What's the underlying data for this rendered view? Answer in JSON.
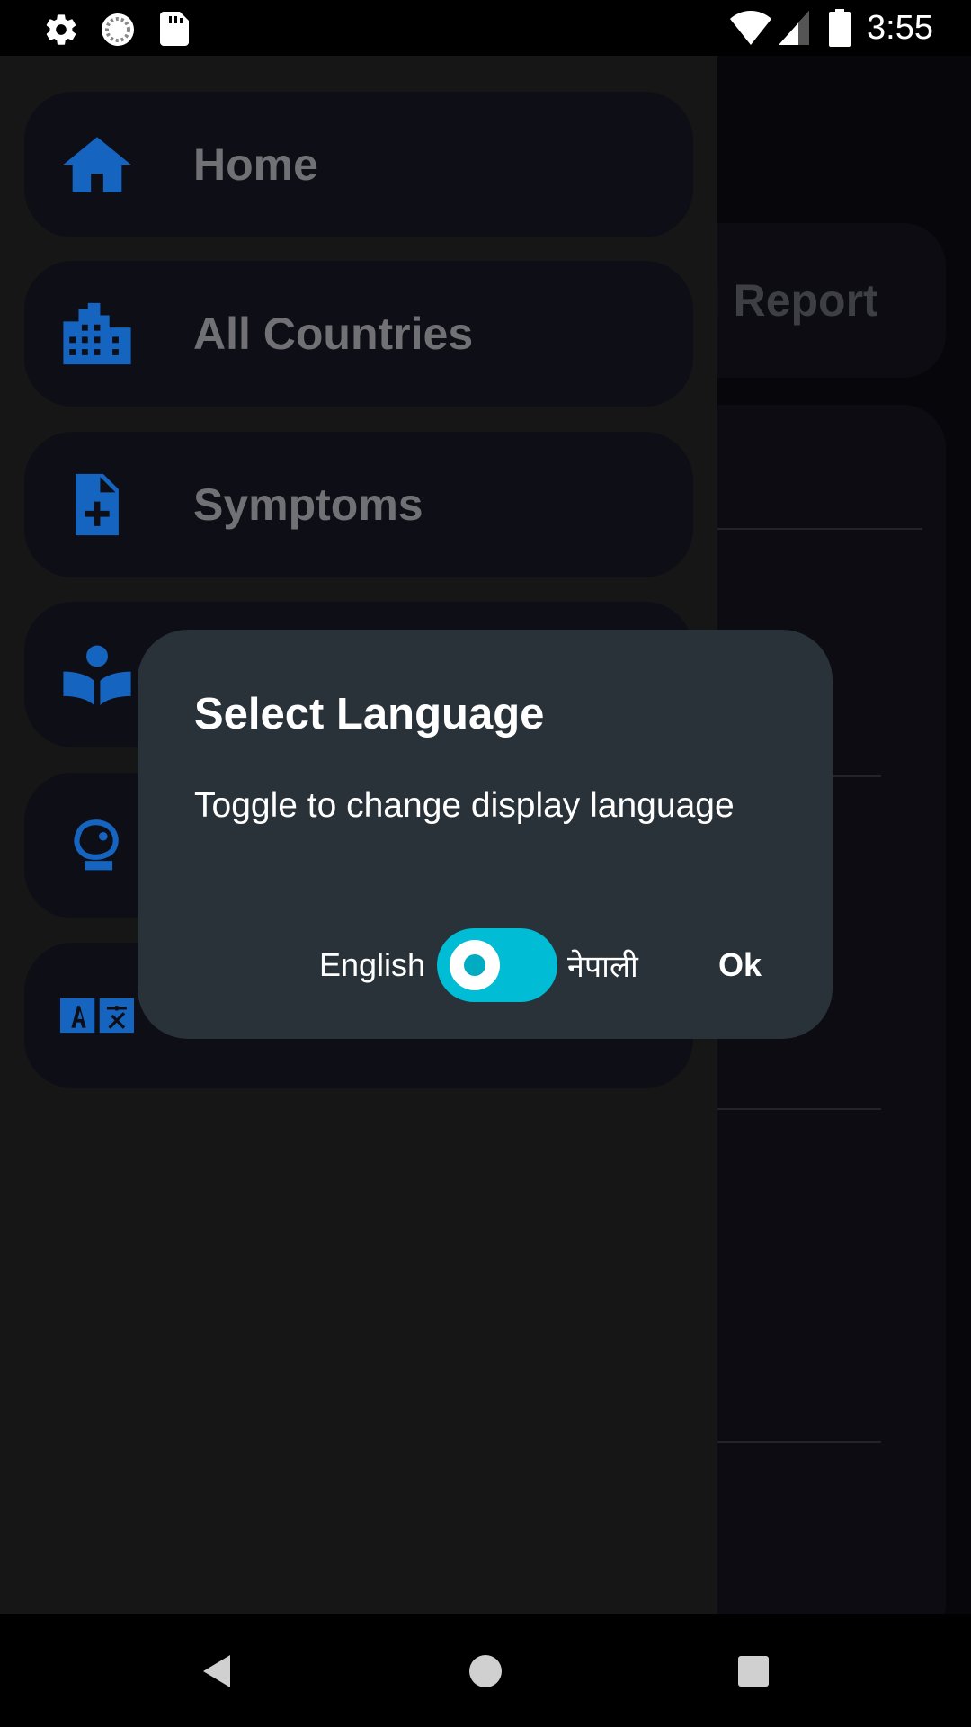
{
  "status_bar": {
    "time": "3:55",
    "left_icons": [
      "settings-icon",
      "sync-icon",
      "sd-card-icon"
    ],
    "right_icons": [
      "wifi-icon",
      "cell-signal-icon",
      "battery-icon"
    ]
  },
  "background": {
    "card_title_partial": "al Report"
  },
  "drawer": {
    "items": [
      {
        "label": "Home",
        "icon": "home-icon"
      },
      {
        "label": "All Countries",
        "icon": "buildings-icon"
      },
      {
        "label": "Symptoms",
        "icon": "medical-file-icon"
      },
      {
        "label": "",
        "icon": "reading-icon"
      },
      {
        "label": "",
        "icon": "mascot-icon"
      },
      {
        "label": "",
        "icon": "translate-icon"
      }
    ]
  },
  "dialog": {
    "title": "Select Language",
    "message": "Toggle to change display language",
    "option_left": "English",
    "option_right": "नेपाली",
    "ok_label": "Ok",
    "toggle_color": "#00bcd4"
  },
  "nav_bar": {
    "buttons": [
      "back-icon",
      "home-circle-icon",
      "recents-icon"
    ]
  },
  "colors": {
    "accent_icon": "#1565c0",
    "dialog_bg": "#283238",
    "drawer_bg": "#161616"
  }
}
